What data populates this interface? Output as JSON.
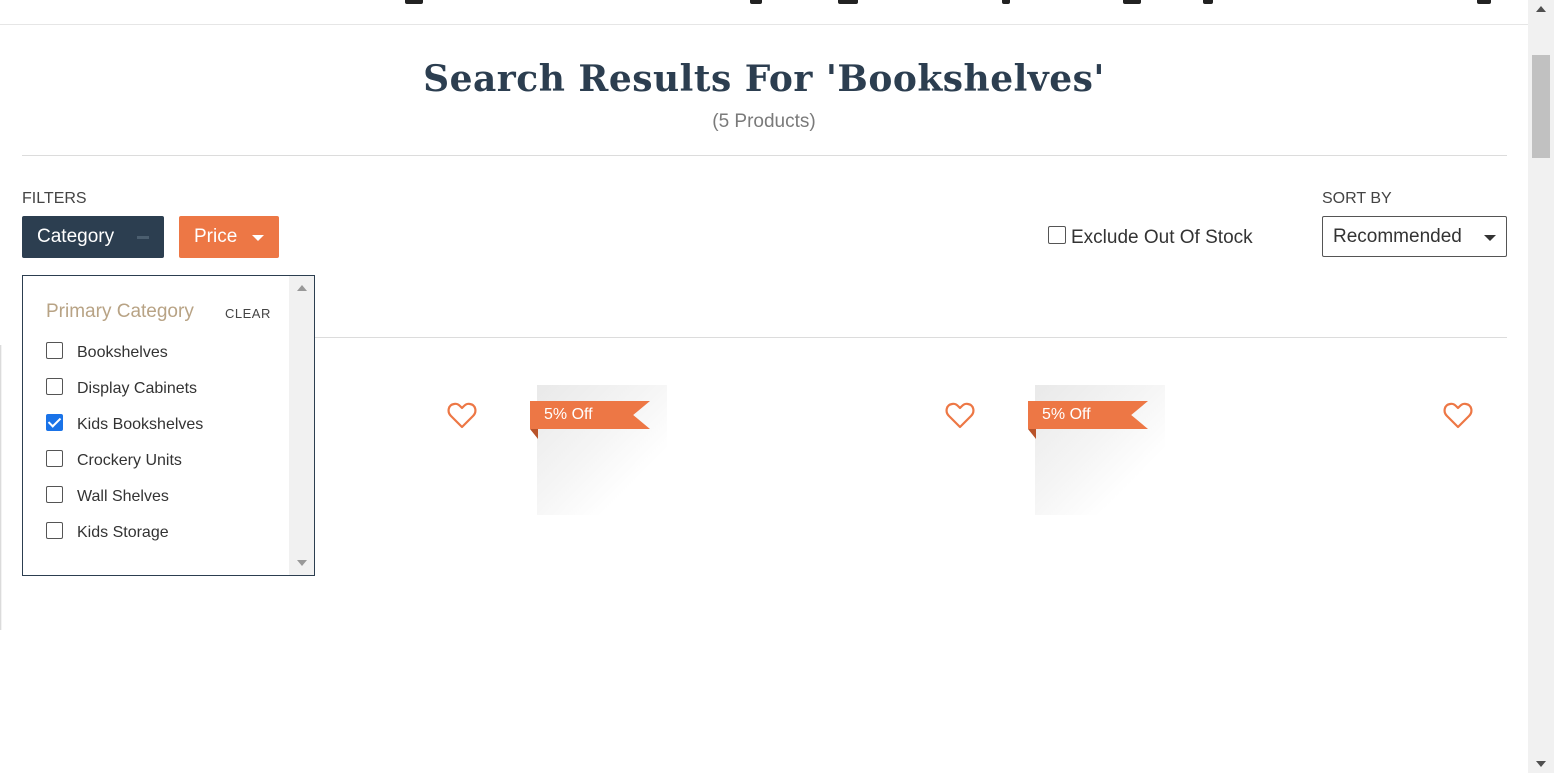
{
  "search": {
    "title": "Search Results For 'Bookshelves'",
    "count": "(5 Products)"
  },
  "filters": {
    "label": "FILTERS",
    "category_button": "Category",
    "price_button": "Price",
    "exclude_out_of_stock": "Exclude Out Of Stock",
    "exclude_checked": false
  },
  "sort": {
    "label": "SORT BY",
    "selected": "Recommended"
  },
  "category_panel": {
    "title": "Primary Category",
    "clear": "CLEAR",
    "options": [
      {
        "label": "Bookshelves",
        "checked": false
      },
      {
        "label": "Display Cabinets",
        "checked": false
      },
      {
        "label": "Kids Bookshelves",
        "checked": true
      },
      {
        "label": "Crockery Units",
        "checked": false
      },
      {
        "label": "Wall Shelves",
        "checked": false
      },
      {
        "label": "Kids Storage",
        "checked": false
      }
    ]
  },
  "products": [
    {
      "badge": "",
      "wishlist_icon": "heart-outline-icon"
    },
    {
      "badge": "5% Off",
      "wishlist_icon": "heart-outline-icon"
    },
    {
      "badge": "5% Off",
      "wishlist_icon": "heart-outline-icon"
    }
  ],
  "colors": {
    "primary_dark": "#2c3e50",
    "accent_orange": "#ed7745",
    "category_title": "#b8a385"
  }
}
